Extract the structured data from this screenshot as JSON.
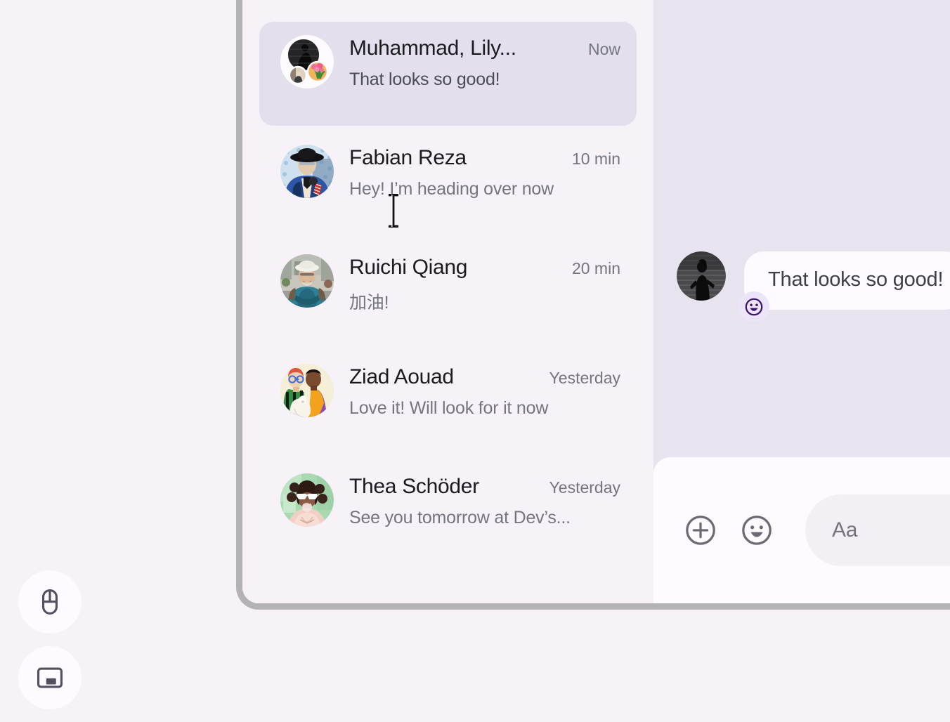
{
  "conversations": [
    {
      "name": "Muhammad, Lily...",
      "time": "Now",
      "snippet": "That looks so good!",
      "avatar_kind": "group-avatar",
      "selected": true
    },
    {
      "name": "Fabian Reza",
      "time": "10 min",
      "snippet": "Hey! I’m heading over now",
      "avatar_kind": "photo-avatar-man-hat",
      "selected": false
    },
    {
      "name": "Ruichi Qiang",
      "time": "20 min",
      "snippet": "加油!",
      "avatar_kind": "photo-avatar-man-cap",
      "selected": false
    },
    {
      "name": "Ziad Aouad",
      "time": "Yesterday",
      "snippet": "Love it! Will look for it now",
      "avatar_kind": "illustration-avatar-couple-dog",
      "selected": false
    },
    {
      "name": "Thea Schöder",
      "time": "Yesterday",
      "snippet": "See you tomorrow at Dev’s...",
      "avatar_kind": "photo-avatar-woman-sunglasses",
      "selected": false
    }
  ],
  "thread": {
    "message": {
      "text": "That looks so good!",
      "avatar_kind": "photo-avatar-silhouette",
      "reaction_icon": "smiley-reaction-icon"
    }
  },
  "composer": {
    "add_icon": "plus-circle-icon",
    "emoji_icon": "smiley-circle-icon",
    "placeholder": "Aa"
  },
  "floating_controls": [
    {
      "icon": "mouse-icon",
      "label": "mouse-pointer-mode"
    },
    {
      "icon": "picture-in-picture-icon",
      "label": "picture-in-picture-mode"
    }
  ],
  "cursor": {
    "type": "text-ibeam-cursor"
  },
  "colors": {
    "page_background": "#f6f2f8",
    "list_background": "#f6f2f8",
    "selected_item": "#e4dfed",
    "chat_background": "#e8e4ef",
    "bubble": "#fdfbff",
    "composer": "#fdfbfe",
    "composer_input": "#f2eff5",
    "reaction_badge": "#ece4f8",
    "reaction_glyph": "#3b1070",
    "name_text": "#1b1b1f",
    "muted_text": "#757580",
    "window_border": "#b3b3b5",
    "float_button": "#fdfbff",
    "float_icon": "#55505f"
  }
}
